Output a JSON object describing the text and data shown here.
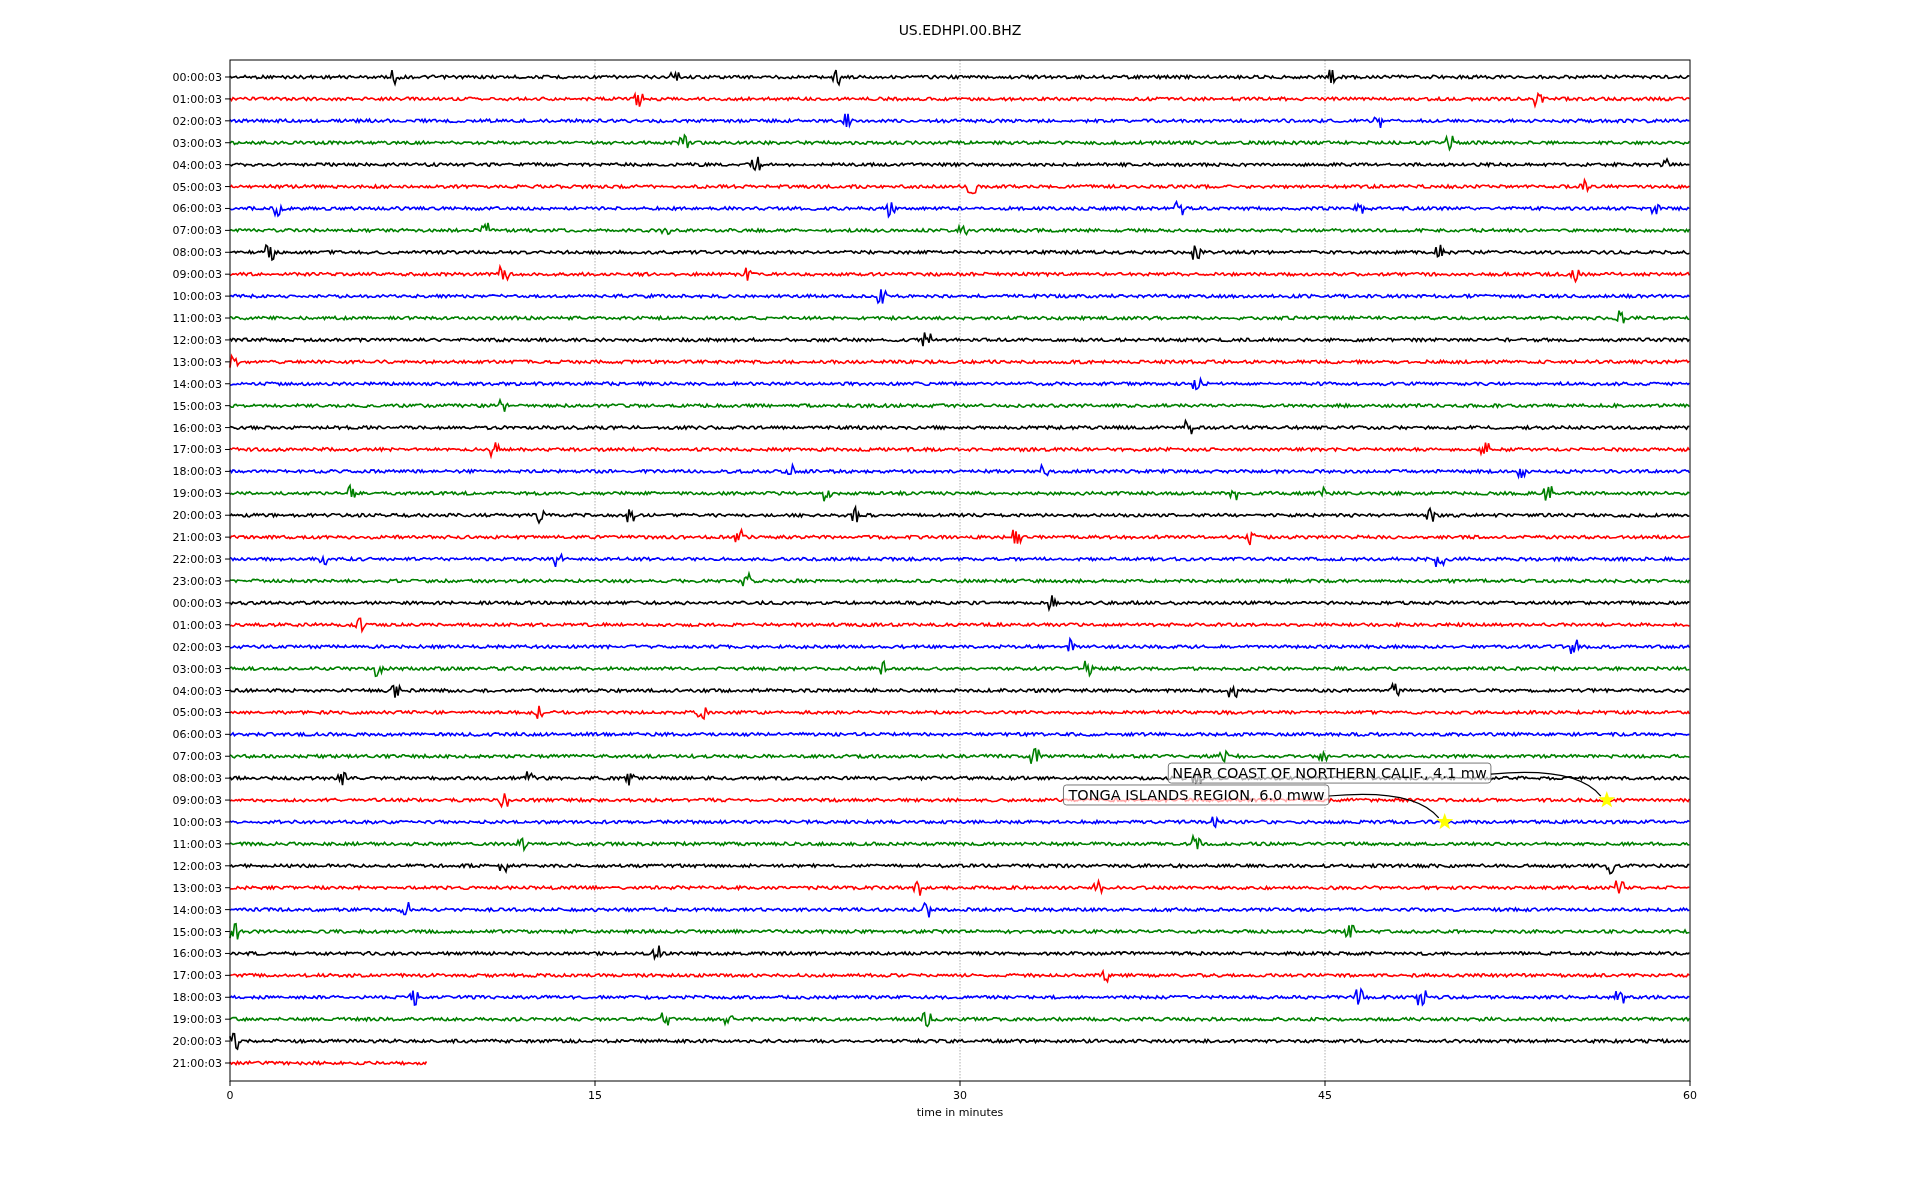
{
  "title": "US.EDHPI.00.BHZ",
  "x_axis": {
    "label": "time in minutes",
    "ticks": [
      "0",
      "15",
      "30",
      "45",
      "60"
    ]
  },
  "traces": [
    {
      "label": "00:00:03",
      "color": "#000000",
      "level": 1
    },
    {
      "label": "01:00:03",
      "color": "#ff0000",
      "level": 1
    },
    {
      "label": "02:00:03",
      "color": "#0000ff",
      "level": 1
    },
    {
      "label": "03:00:03",
      "color": "#008000",
      "level": 1
    },
    {
      "label": "04:00:03",
      "color": "#000000",
      "level": 1
    },
    {
      "label": "05:00:03",
      "color": "#ff0000",
      "level": 1
    },
    {
      "label": "06:00:03",
      "color": "#0000ff",
      "level": 1
    },
    {
      "label": "07:00:03",
      "color": "#008000",
      "level": 1
    },
    {
      "label": "08:00:03",
      "color": "#000000",
      "level": 1
    },
    {
      "label": "09:00:03",
      "color": "#ff0000",
      "level": 1
    },
    {
      "label": "10:00:03",
      "color": "#0000ff",
      "level": 1
    },
    {
      "label": "11:00:03",
      "color": "#008000",
      "level": 1
    },
    {
      "label": "12:00:03",
      "color": "#000000",
      "level": 1
    },
    {
      "label": "13:00:03",
      "color": "#ff0000",
      "level": 1
    },
    {
      "label": "14:00:03",
      "color": "#0000ff",
      "level": 1
    },
    {
      "label": "15:00:03",
      "color": "#008000",
      "level": 1
    },
    {
      "label": "16:00:03",
      "color": "#000000",
      "level": 1
    },
    {
      "label": "17:00:03",
      "color": "#ff0000",
      "level": 1
    },
    {
      "label": "18:00:03",
      "color": "#0000ff",
      "level": 1
    },
    {
      "label": "19:00:03",
      "color": "#008000",
      "level": 1
    },
    {
      "label": "20:00:03",
      "color": "#000000",
      "level": 1
    },
    {
      "label": "21:00:03",
      "color": "#ff0000",
      "level": 1
    },
    {
      "label": "22:00:03",
      "color": "#0000ff",
      "level": 1
    },
    {
      "label": "23:00:03",
      "color": "#008000",
      "level": 1
    },
    {
      "label": "00:00:03",
      "color": "#000000",
      "level": 1
    },
    {
      "label": "01:00:03",
      "color": "#ff0000",
      "level": 1
    },
    {
      "label": "02:00:03",
      "color": "#0000ff",
      "level": 1
    },
    {
      "label": "03:00:03",
      "color": "#008000",
      "level": 1
    },
    {
      "label": "04:00:03",
      "color": "#000000",
      "level": 1
    },
    {
      "label": "05:00:03",
      "color": "#ff0000",
      "level": 1
    },
    {
      "label": "06:00:03",
      "color": "#0000ff",
      "level": 1
    },
    {
      "label": "07:00:03",
      "color": "#008000",
      "level": 1
    },
    {
      "label": "08:00:03",
      "color": "#000000",
      "level": 1
    },
    {
      "label": "09:00:03",
      "color": "#ff0000",
      "level": 1,
      "events": [
        {
          "label": "NEAR COAST OF NORTHERN CALIF., 4.1 mw",
          "level": 0.943
        }
      ]
    },
    {
      "label": "10:00:03",
      "color": "#0000ff",
      "level": 1,
      "events": [
        {
          "label": "TONGA ISLANDS REGION, 6.0 mww",
          "level": 0.832
        }
      ]
    },
    {
      "label": "11:00:03",
      "color": "#008000",
      "level": 1
    },
    {
      "label": "12:00:03",
      "color": "#000000",
      "level": 1
    },
    {
      "label": "13:00:03",
      "color": "#ff0000",
      "level": 1
    },
    {
      "label": "14:00:03",
      "color": "#0000ff",
      "level": 1
    },
    {
      "label": "15:00:03",
      "color": "#008000",
      "level": 1
    },
    {
      "label": "16:00:03",
      "color": "#000000",
      "level": 1
    },
    {
      "label": "17:00:03",
      "color": "#ff0000",
      "level": 1
    },
    {
      "label": "18:00:03",
      "color": "#0000ff",
      "level": 1
    },
    {
      "label": "19:00:03",
      "color": "#008000",
      "level": 1
    },
    {
      "label": "20:00:03",
      "color": "#000000",
      "level": 1
    },
    {
      "label": "21:00:03",
      "color": "#ff0000",
      "level": 0.135
    }
  ]
}
